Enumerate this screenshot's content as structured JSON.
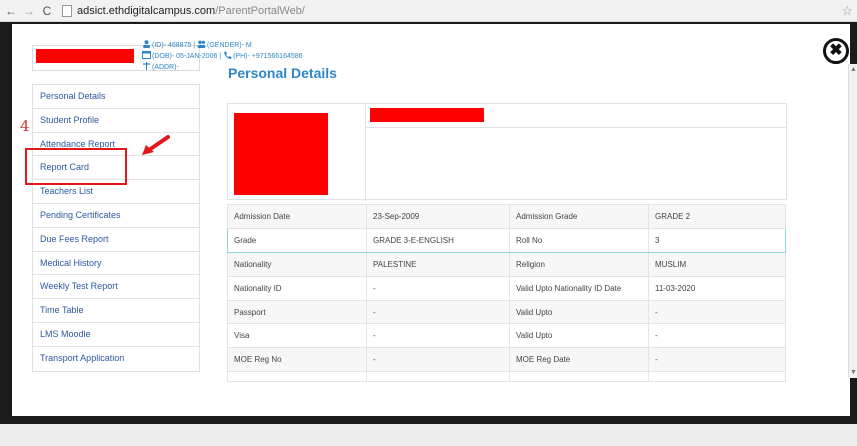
{
  "browser": {
    "url_host": "adsict.ethdigitalcampus.com",
    "url_path": "/ParentPortalWeb/"
  },
  "close_label": "✖",
  "sidebar": {
    "items": [
      {
        "label": "Personal Details"
      },
      {
        "label": "Student Profile"
      },
      {
        "label": "Attendance Report"
      },
      {
        "label": "Report Card"
      },
      {
        "label": "Teachers List"
      },
      {
        "label": "Pending Certificates"
      },
      {
        "label": "Due Fees Report"
      },
      {
        "label": "Medical History"
      },
      {
        "label": "Weekly Test Report"
      },
      {
        "label": "Time Table"
      },
      {
        "label": "LMS Moodle"
      },
      {
        "label": "Transport Application"
      }
    ]
  },
  "annotation": {
    "step_number": "4",
    "color": "#e3161b"
  },
  "main": {
    "title": "Personal Details",
    "profile": {
      "id_text": "(ID)- 468875 |",
      "gender_text": "(GENDER)- M",
      "dob_text": "(DOB)- 05-JAN-2006 |",
      "phone_text": "(PH)- +971566164586",
      "addr_text": "(ADDR)-"
    },
    "rows": [
      {
        "l1": "Admission Date",
        "v1": "23-Sep-2009",
        "l2": "Admission Grade",
        "v2": "GRADE 2"
      },
      {
        "l1": "Grade",
        "v1": "GRADE 3-E-ENGLISH",
        "l2": "Roll No",
        "v2": "3"
      },
      {
        "l1": "Nationality",
        "v1": "PALESTINE",
        "l2": "Religion",
        "v2": "MUSLIM"
      },
      {
        "l1": "Nationality ID",
        "v1": "-",
        "l2": "Valid Upto Nationality ID Date",
        "v2": "11-03-2020"
      },
      {
        "l1": "Passport",
        "v1": "-",
        "l2": "Valid Upto",
        "v2": "-"
      },
      {
        "l1": "Visa",
        "v1": "-",
        "l2": "Valid Upto",
        "v2": "-"
      },
      {
        "l1": "MOE Reg No",
        "v1": "-",
        "l2": "MOE Reg Date",
        "v2": "-"
      },
      {
        "l1": "",
        "v1": "",
        "l2": "",
        "v2": ""
      }
    ]
  },
  "colors": {
    "accent": "#2d86c6",
    "link": "#2a5aa0",
    "redaction": "#ff0000",
    "highlight_border": "#8ed6e6"
  }
}
